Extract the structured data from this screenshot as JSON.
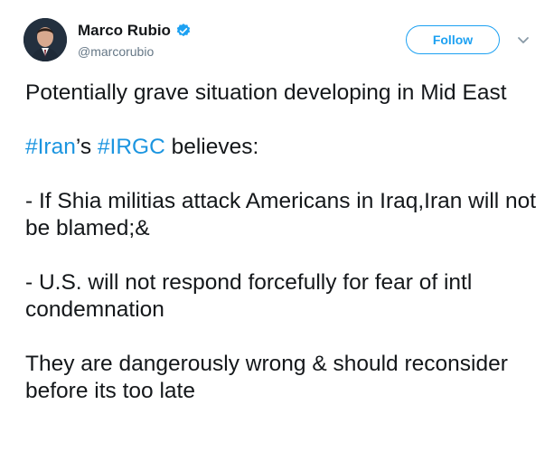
{
  "author": {
    "name": "Marco Rubio",
    "handle": "@marcorubio",
    "verified": true
  },
  "actions": {
    "follow_label": "Follow",
    "menu_icon": "chevron-down-icon"
  },
  "tweet": {
    "line1": "Potentially grave situation developing in Mid East",
    "hashtag1": "#Iran",
    "text_after_hashtag1": "’s ",
    "hashtag2": "#IRGC",
    "text_after_hashtag2": " believes:",
    "point1": "- If Shia militias attack Americans in Iraq,Iran will not be blamed;&",
    "point2": "- U.S. will not respond forcefully for fear of intl condemnation",
    "closing": "They are dangerously wrong & should reconsider before its too late"
  },
  "colors": {
    "link": "#1b95e0",
    "follow": "#1da1f2",
    "handle": "#657786",
    "text": "#14171a"
  }
}
